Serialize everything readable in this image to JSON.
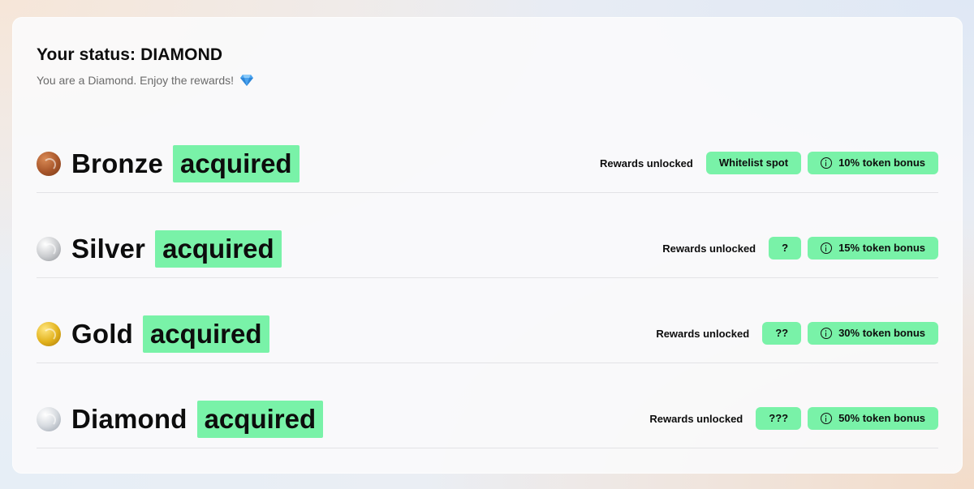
{
  "status": {
    "title": "Your status: DIAMOND",
    "subtitle": "You are a Diamond. Enjoy the rewards!",
    "subtitle_icon": "gem-icon"
  },
  "colors": {
    "accent_green": "#79f2a8",
    "bronze": "#a8562a",
    "silver": "#c9cbce",
    "gold": "#e2b21c",
    "diamond": "#d7dbe0"
  },
  "tiers": [
    {
      "name": "Bronze",
      "badge": "acquired",
      "rewards_label": "Rewards unlocked",
      "reward": "Whitelist spot",
      "bonus": "10% token bonus"
    },
    {
      "name": "Silver",
      "badge": "acquired",
      "rewards_label": "Rewards unlocked",
      "reward": "?",
      "bonus": "15% token bonus"
    },
    {
      "name": "Gold",
      "badge": "acquired",
      "rewards_label": "Rewards unlocked",
      "reward": "??",
      "bonus": "30% token bonus"
    },
    {
      "name": "Diamond",
      "badge": "acquired",
      "rewards_label": "Rewards unlocked",
      "reward": "???",
      "bonus": "50% token bonus"
    }
  ]
}
